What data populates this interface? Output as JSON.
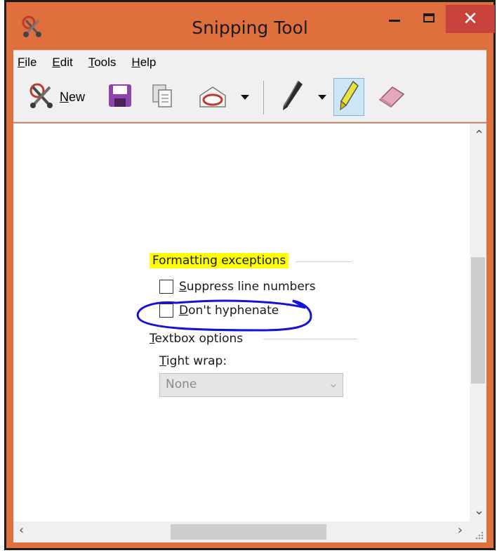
{
  "window": {
    "title": "Snipping Tool",
    "close_glyph": "✕",
    "minimize_glyph": "—",
    "maximize_glyph": "☐"
  },
  "menu": [
    "File",
    "Edit",
    "Tools",
    "Help"
  ],
  "toolbar": {
    "new_label": "New",
    "icons": [
      "scissors-icon",
      "save-icon",
      "copy-icon",
      "send-email-icon",
      "pen-icon",
      "highlighter-icon",
      "eraser-icon"
    ]
  },
  "snip": {
    "section1": "Formatting exceptions",
    "checkbox1": "Suppress line numbers",
    "checkbox2": "Don't hyphenate",
    "section2": "Textbox options",
    "field_label": "Tight wrap:",
    "field_value": "None"
  },
  "colors": {
    "titlebar": "#df6f3d",
    "close": "#c8413b",
    "highlight": "#ffff00",
    "ink": "#1414d8"
  }
}
